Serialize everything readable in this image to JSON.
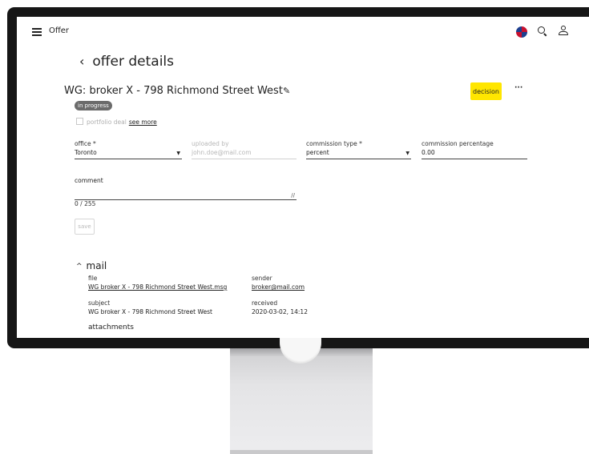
{
  "app": {
    "title": "Offer"
  },
  "page": {
    "back_label": "offer details"
  },
  "offer": {
    "title": "WG: broker X - 798 Richmond Street West",
    "status": "in progress",
    "decision_label": "decision",
    "more_label": "···"
  },
  "portfolio": {
    "label": "portfolio deal",
    "see_more": "see more",
    "checked": false
  },
  "form": {
    "office": {
      "label": "office *",
      "value": "Toronto"
    },
    "uploaded_by": {
      "label": "uploaded by",
      "value": "john.doe@mail.com"
    },
    "commission_type": {
      "label": "commission type *",
      "value": "percent"
    },
    "commission_percentage": {
      "label": "commission percentage",
      "value": "0.00"
    },
    "comment": {
      "label": "comment",
      "value": "",
      "counter": "0 / 255"
    },
    "save_label": "save"
  },
  "mail": {
    "heading": "mail",
    "file_label": "file",
    "file_value": "WG broker X - 798 Richmond Street West.msg",
    "sender_label": "sender",
    "sender_value": "broker@mail.com",
    "subject_label": "subject",
    "subject_value": "WG broker X - 798 Richmond Street West",
    "received_label": "received",
    "received_value": "2020-03-02, 14:12",
    "attachments_label": "attachments"
  },
  "icons": {
    "menu": "hamburger-menu-icon",
    "avatar": "avatar",
    "search": "search-icon",
    "user": "user-icon",
    "back": "chevron-left-icon",
    "edit": "pencil-icon",
    "dropdown": "caret-down-icon",
    "resize": "resize-handle-icon",
    "collapse": "chevron-up-icon"
  },
  "colors": {
    "accent": "#ffe600",
    "badge": "#6b6b6b"
  }
}
